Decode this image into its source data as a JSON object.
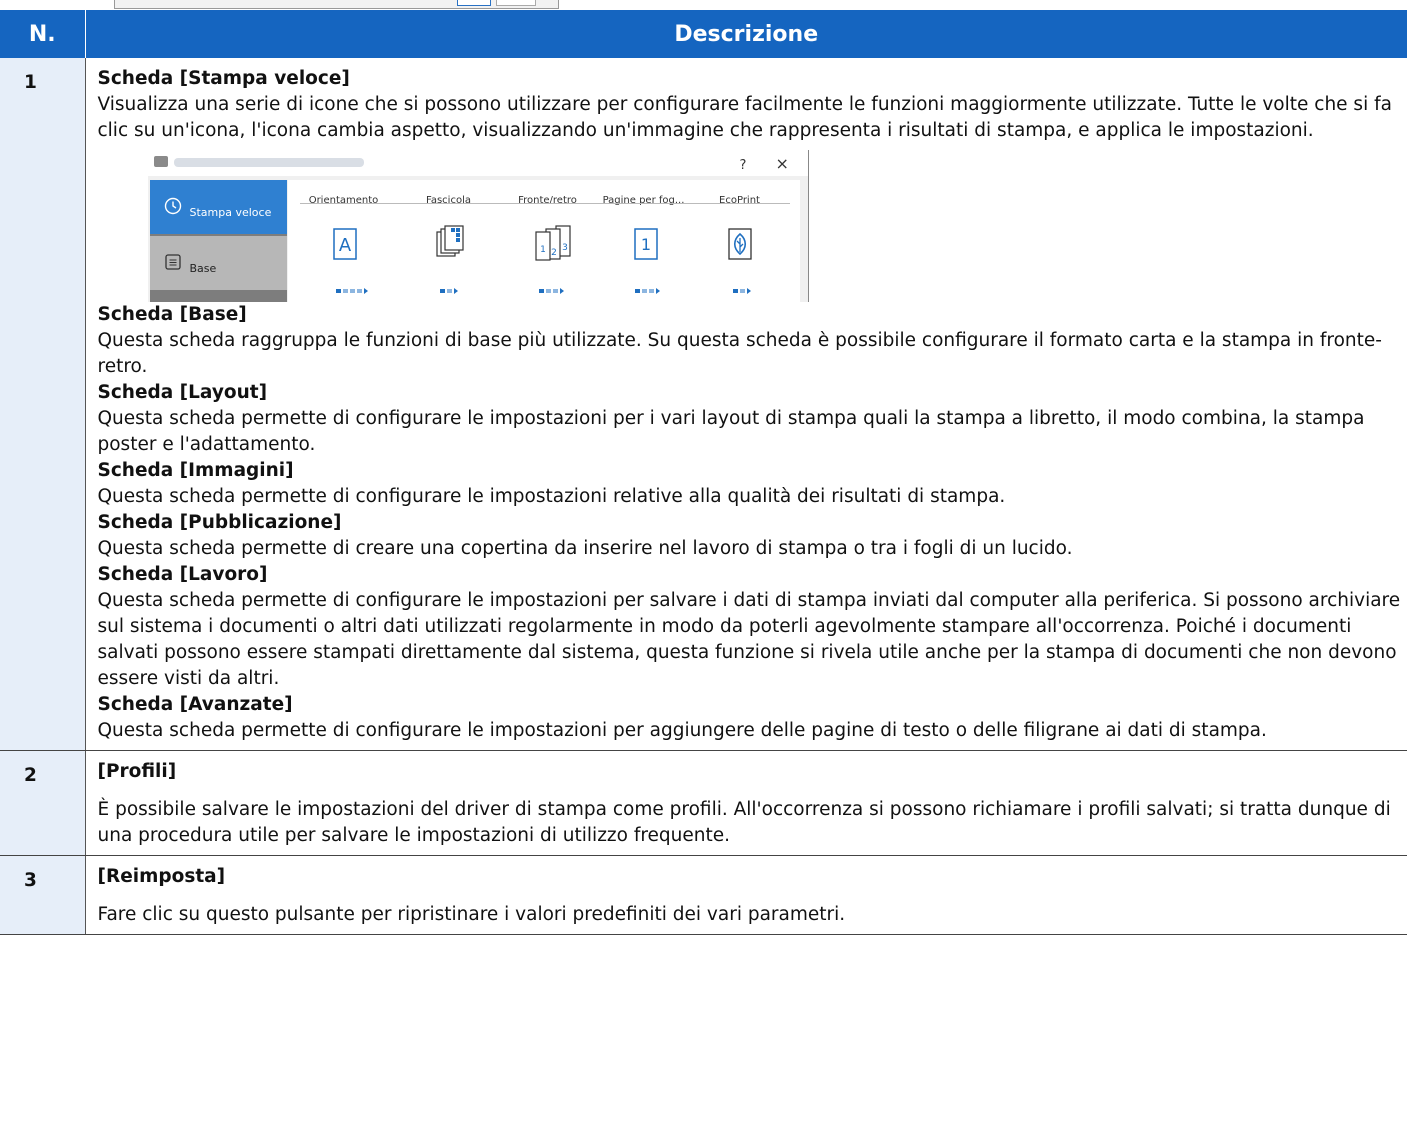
{
  "table": {
    "header": {
      "num": "N.",
      "desc": "Descrizione"
    },
    "rows": [
      {
        "num": "1",
        "title": "Scheda [Stampa veloce]",
        "text": "Visualizza una serie di icone che si possono utilizzare per configurare facilmente le funzioni maggiormente utilizzate. Tutte le volte che si fa clic su un'icona, l'icona cambia aspetto, visualizzando un'immagine che rappresenta i risultati di stampa, e applica le impostazioni.",
        "sections": [
          {
            "title": "Scheda [Base]",
            "text": "Questa scheda raggruppa le funzioni di base più utilizzate. Su questa scheda è possibile configurare il formato carta e la stampa in fronte-retro."
          },
          {
            "title": "Scheda [Layout]",
            "text": "Questa scheda permette di configurare le impostazioni per i vari layout di stampa quali la stampa a libretto, il modo combina, la stampa poster e l'adattamento."
          },
          {
            "title": "Scheda [Immagini]",
            "text": "Questa scheda permette di configurare le impostazioni relative alla qualità dei risultati di stampa."
          },
          {
            "title": "Scheda [Pubblicazione]",
            "text": "Questa scheda permette di creare una copertina da inserire nel lavoro di stampa o tra i fogli di un lucido."
          },
          {
            "title": "Scheda [Lavoro]",
            "text": "Questa scheda permette di configurare le impostazioni per salvare i dati di stampa inviati dal computer alla periferica. Si possono archiviare sul sistema i documenti o altri dati utilizzati regolarmente in modo da poterli agevolmente stampare all'occorrenza. Poiché i documenti salvati possono essere stampati direttamente dal sistema, questa funzione si rivela utile anche per la stampa di documenti che non devono essere visti da altri."
          },
          {
            "title": "Scheda [Avanzate]",
            "text": "Questa scheda permette di configurare le impostazioni per aggiungere delle pagine di testo o delle filigrane ai dati di stampa."
          }
        ]
      },
      {
        "num": "2",
        "title": "[Profili]",
        "text": "È possibile salvare le impostazioni del driver di stampa come profili. All'occorrenza si possono richiamare i profili salvati; si tratta dunque di una procedura utile per salvare le impostazioni di utilizzo frequente."
      },
      {
        "num": "3",
        "title": "[Reimposta]",
        "text": "Fare clic su questo pulsante per ripristinare i valori predefiniti dei vari parametri."
      }
    ]
  },
  "dialog": {
    "help": "?",
    "close": "×",
    "tabs": [
      "Stampa veloce",
      "Base"
    ],
    "options": [
      "Orientamento",
      "Fascicola",
      "Fronte/retro",
      "Pagine per fog...",
      "EcoPrint"
    ],
    "icon_glyphs": [
      "A",
      "1",
      "1",
      "2",
      "3",
      "1"
    ],
    "dot_states": [
      [
        true,
        false,
        false,
        false
      ],
      [
        true,
        false
      ],
      [
        true,
        false,
        false
      ],
      [
        true,
        false,
        false
      ],
      [
        true,
        false
      ]
    ],
    "colors": {
      "accent": "#2f80d1",
      "header": "#1565c0",
      "num_cell": "#e6eef9"
    }
  }
}
